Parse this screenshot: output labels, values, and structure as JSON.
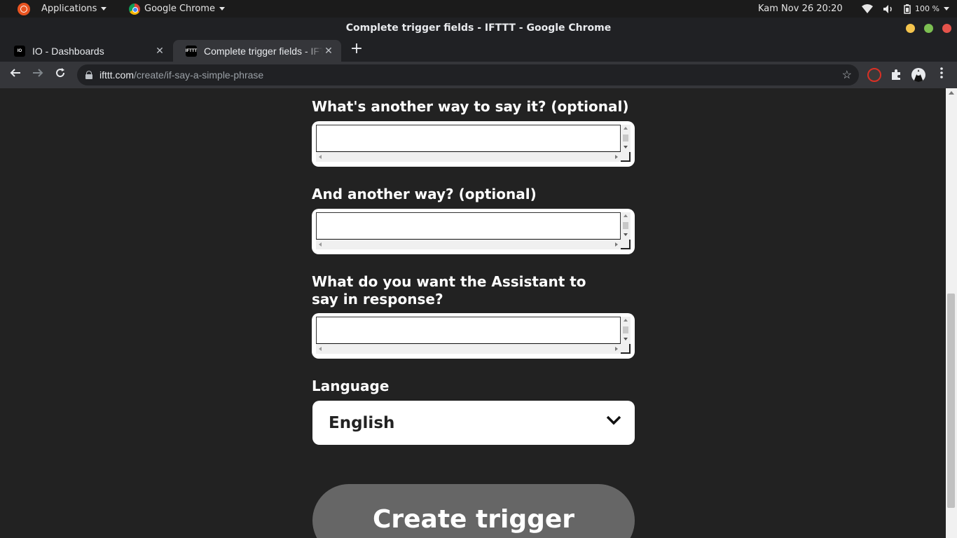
{
  "system_bar": {
    "applications_label": "Applications",
    "chrome_label": "Google Chrome",
    "datetime": "Kam Nov 26  20:20",
    "battery": "100 %"
  },
  "window": {
    "title": "Complete trigger fields - IFTTT - Google Chrome"
  },
  "tabs": [
    {
      "label": "IO - Dashboards",
      "favicon": "io-icon"
    },
    {
      "label": "Complete trigger fields - IFTTT",
      "favicon": "ifttt-icon"
    }
  ],
  "address_bar": {
    "host": "ifttt.com",
    "path": "/create/if-say-a-simple-phrase"
  },
  "form": {
    "fields": [
      {
        "label": "What's another way to say it? (optional)",
        "value": ""
      },
      {
        "label": "And another way? (optional)",
        "value": ""
      },
      {
        "label": "What do you want the Assistant to say in response?",
        "value": ""
      }
    ],
    "language_label": "Language",
    "language_value": "English",
    "submit_label": "Create trigger"
  },
  "colors": {
    "page_bg": "#222222",
    "button_bg": "#666666"
  }
}
